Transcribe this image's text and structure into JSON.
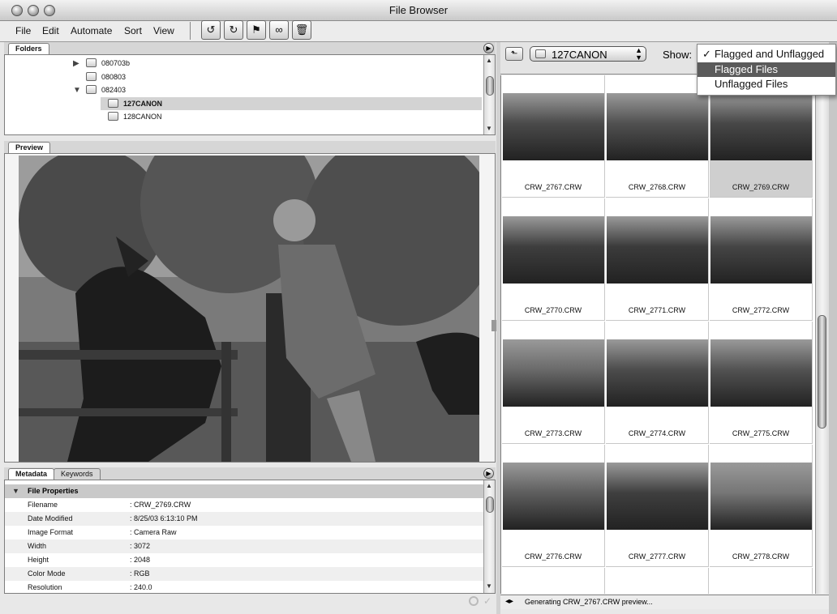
{
  "window": {
    "title": "File Browser"
  },
  "menu": [
    "File",
    "Edit",
    "Automate",
    "Sort",
    "View"
  ],
  "toolbar": [
    {
      "icon": "rotate-ccw-icon",
      "glyph": "↺"
    },
    {
      "icon": "rotate-cw-icon",
      "glyph": "↻"
    },
    {
      "icon": "flag-icon",
      "glyph": "⚑"
    },
    {
      "icon": "binoculars-icon",
      "glyph": "∞"
    },
    {
      "icon": "trash-icon",
      "glyph": "🗑"
    }
  ],
  "folders": {
    "tab": "Folders",
    "items": [
      {
        "name": "080703b",
        "level": 0,
        "expander": "▶"
      },
      {
        "name": "080803",
        "level": 0,
        "expander": ""
      },
      {
        "name": "082403",
        "level": 0,
        "expander": "▼"
      },
      {
        "name": "127CANON",
        "level": 1,
        "expander": "",
        "selected": true
      },
      {
        "name": "128CANON",
        "level": 1,
        "expander": ""
      }
    ]
  },
  "preview": {
    "tab": "Preview"
  },
  "metadata": {
    "tabs": [
      "Metadata",
      "Keywords"
    ],
    "section": "File Properties",
    "rows": [
      {
        "key": "Filename",
        "value": ": CRW_2769.CRW"
      },
      {
        "key": "Date Modified",
        "value": ": 8/25/03 6:13:10 PM"
      },
      {
        "key": "Image Format",
        "value": ": Camera Raw"
      },
      {
        "key": "Width",
        "value": ": 3072"
      },
      {
        "key": "Height",
        "value": ": 2048"
      },
      {
        "key": "Color Mode",
        "value": ": RGB"
      },
      {
        "key": "Resolution",
        "value": ": 240.0"
      }
    ]
  },
  "browser": {
    "location": "127CANON",
    "show_label": "Show:",
    "show_options": [
      {
        "label": "Flagged and Unflagged",
        "checked": true
      },
      {
        "label": "Flagged Files",
        "highlighted": true
      },
      {
        "label": "Unflagged Files"
      }
    ],
    "thumbnails": [
      {
        "name": "CRW_2767.CRW",
        "tone": "#4a4a4a"
      },
      {
        "name": "CRW_2768.CRW",
        "tone": "#505050"
      },
      {
        "name": "CRW_2769.CRW",
        "tone": "#474747",
        "selected": true
      },
      {
        "name": "CRW_2770.CRW",
        "tone": "#3e3e3e"
      },
      {
        "name": "CRW_2771.CRW",
        "tone": "#3b3b3b"
      },
      {
        "name": "CRW_2772.CRW",
        "tone": "#454545"
      },
      {
        "name": "CRW_2773.CRW",
        "tone": "#6a6a6a"
      },
      {
        "name": "CRW_2774.CRW",
        "tone": "#4c4c4c"
      },
      {
        "name": "CRW_2775.CRW",
        "tone": "#525252"
      },
      {
        "name": "CRW_2776.CRW",
        "tone": "#5e5e5e"
      },
      {
        "name": "CRW_2777.CRW",
        "tone": "#3f3f3f"
      },
      {
        "name": "CRW_2778.CRW",
        "tone": "#767676"
      }
    ],
    "status": "Generating CRW_2767.CRW preview..."
  }
}
